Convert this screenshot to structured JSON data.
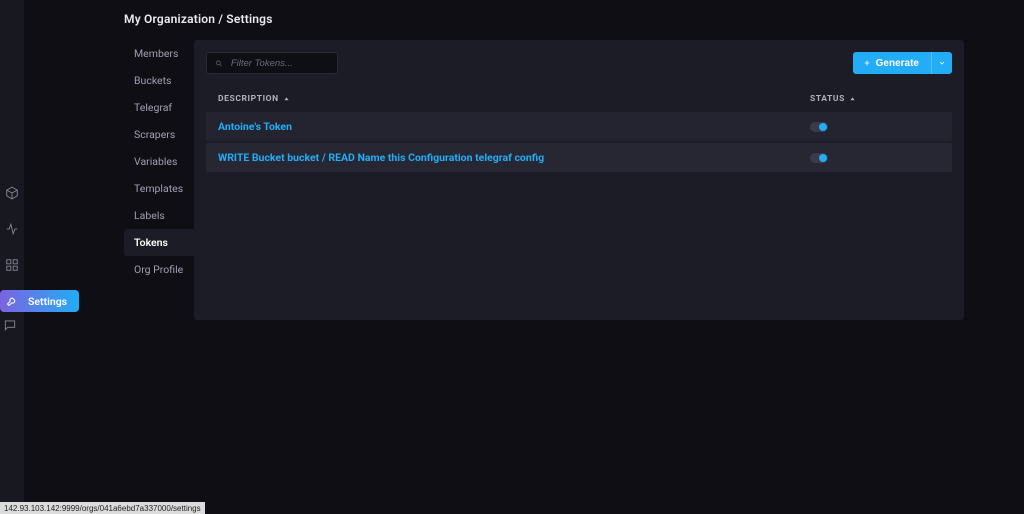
{
  "breadcrumb": "My Organization / Settings",
  "rail_icons": [
    {
      "name": "cube-icon"
    },
    {
      "name": "pulse-icon"
    },
    {
      "name": "grid-icon"
    },
    {
      "name": "calendar-icon"
    },
    {
      "name": "wrench-icon"
    },
    {
      "name": "chat-icon"
    }
  ],
  "settings_pill": {
    "label": "Settings"
  },
  "tabs": [
    {
      "label": "Members",
      "active": false
    },
    {
      "label": "Buckets",
      "active": false
    },
    {
      "label": "Telegraf",
      "active": false
    },
    {
      "label": "Scrapers",
      "active": false
    },
    {
      "label": "Variables",
      "active": false
    },
    {
      "label": "Templates",
      "active": false
    },
    {
      "label": "Labels",
      "active": false
    },
    {
      "label": "Tokens",
      "active": true
    },
    {
      "label": "Org Profile",
      "active": false
    }
  ],
  "filter": {
    "placeholder": "Filter Tokens..."
  },
  "generate": {
    "label": "Generate"
  },
  "columns": {
    "description": "DESCRIPTION",
    "status": "STATUS"
  },
  "rows": [
    {
      "description": "Antoine's Token",
      "status_on": true
    },
    {
      "description": "WRITE Bucket bucket / READ Name this Configuration telegraf config",
      "status_on": true
    }
  ],
  "statusbar": "142.93.103.142:9999/orgs/041a6ebd7a337000/settings"
}
